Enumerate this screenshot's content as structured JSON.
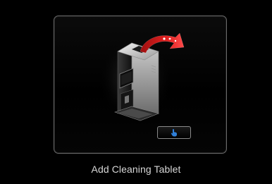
{
  "screen": {
    "caption": "Add Cleaning Tablet"
  },
  "illustration": {
    "icon": "coffee-machine-with-tablet-icon",
    "arrow_color": "#e02020",
    "machine_color": "#b8b8b8"
  },
  "confirm_button": {
    "icon": "touch-icon",
    "icon_color": "#2f7fd8"
  }
}
